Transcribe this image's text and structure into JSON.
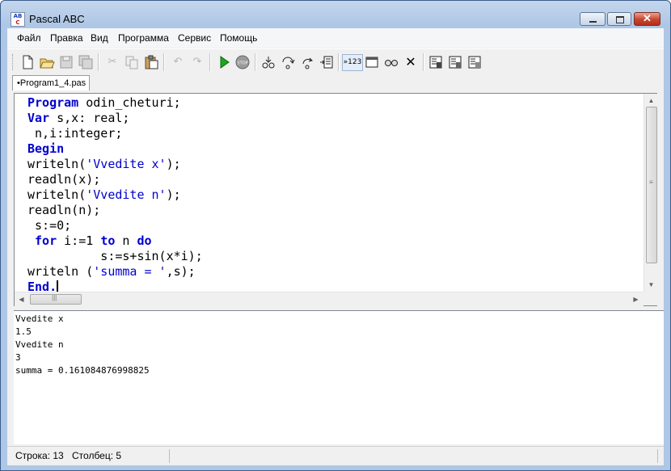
{
  "window": {
    "title": "Pascal ABC"
  },
  "menu": [
    "Файл",
    "Правка",
    "Вид",
    "Программа",
    "Сервис",
    "Помощь"
  ],
  "toolbar": {
    "counter_label": "»123",
    "buttons": [
      "new-file",
      "open-folder",
      "save",
      "save-all",
      "cut",
      "copy",
      "paste",
      "undo",
      "redo",
      "run",
      "stop",
      "step-into",
      "step-over",
      "step-out",
      "run-to-cursor",
      "output-view",
      "console-window",
      "watch",
      "clear-breakpoints",
      "debug-1",
      "debug-2",
      "debug-3"
    ]
  },
  "tab": {
    "label": "•Program1_4.pas"
  },
  "editor": {
    "lines": [
      [
        {
          "t": "Program",
          "c": "kw"
        },
        {
          "t": " odin_cheturi;",
          "c": ""
        }
      ],
      [
        {
          "t": "Var",
          "c": "kw"
        },
        {
          "t": " s,x: real;",
          "c": ""
        }
      ],
      [
        {
          "t": " n,i:integer;",
          "c": ""
        }
      ],
      [
        {
          "t": "Begin",
          "c": "kw"
        }
      ],
      [
        {
          "t": "writeln(",
          "c": ""
        },
        {
          "t": "'Vvedite x'",
          "c": "str"
        },
        {
          "t": ");",
          "c": ""
        }
      ],
      [
        {
          "t": "readln(x);",
          "c": ""
        }
      ],
      [
        {
          "t": "writeln(",
          "c": ""
        },
        {
          "t": "'Vvedite n'",
          "c": "str"
        },
        {
          "t": ");",
          "c": ""
        }
      ],
      [
        {
          "t": "readln(n);",
          "c": ""
        }
      ],
      [
        {
          "t": " s:=0;",
          "c": ""
        }
      ],
      [
        {
          "t": " ",
          "c": ""
        },
        {
          "t": "for",
          "c": "kw"
        },
        {
          "t": " i:=1 ",
          "c": ""
        },
        {
          "t": "to",
          "c": "kw"
        },
        {
          "t": " n ",
          "c": ""
        },
        {
          "t": "do",
          "c": "kw"
        }
      ],
      [
        {
          "t": "          s:=s+sin(x*i);",
          "c": ""
        }
      ],
      [
        {
          "t": "writeln (",
          "c": ""
        },
        {
          "t": "'summa = '",
          "c": "str"
        },
        {
          "t": ",s);",
          "c": ""
        }
      ],
      [
        {
          "t": "End.",
          "c": "kw"
        }
      ]
    ]
  },
  "output": {
    "lines": [
      "Vvedite x",
      "1.5",
      "Vvedite n",
      "3",
      "summa = 0.161084876998825"
    ]
  },
  "status": {
    "line": "Строка: 13",
    "column": "Столбец: 5"
  }
}
